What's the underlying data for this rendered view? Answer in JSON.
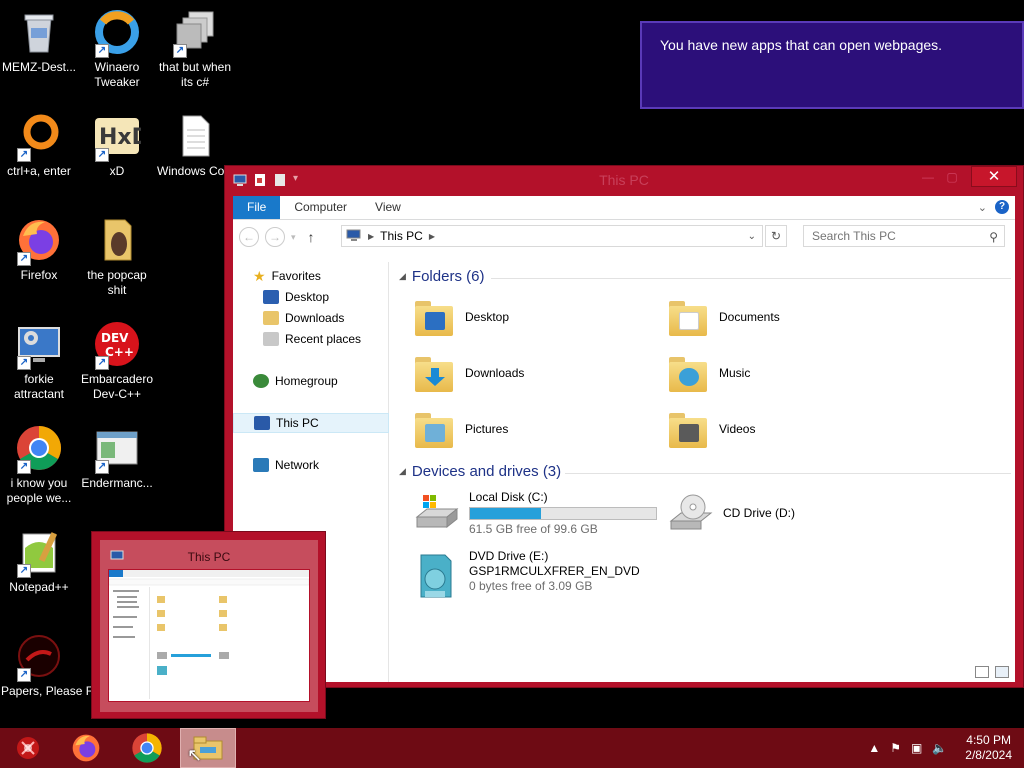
{
  "desktop": {
    "icons": [
      {
        "label": "MEMZ-Dest...",
        "icon": "recycle-bin-icon"
      },
      {
        "label": "Winaero Tweaker",
        "icon": "winaero-icon"
      },
      {
        "label": "that but when its c#",
        "icon": "windows-stack-icon"
      },
      {
        "label": "ctrl+a, enter",
        "icon": "ring-icon"
      },
      {
        "label": "xD",
        "icon": "hxd-icon"
      },
      {
        "label": "Windows Compatibili...",
        "icon": "document-icon"
      },
      {
        "label": "Firefox",
        "icon": "firefox-icon"
      },
      {
        "label": "the popcap shit",
        "icon": "popcap-folder-icon"
      },
      {
        "label": "forkie attractant",
        "icon": "monitor-gear-icon"
      },
      {
        "label": "Embarcadero Dev-C++",
        "icon": "devcpp-icon"
      },
      {
        "label": "i know you people we...",
        "icon": "chrome-icon"
      },
      {
        "label": "Endermanc...",
        "icon": "window-icon"
      },
      {
        "label": "Notepad++",
        "icon": "notepadpp-icon"
      },
      {
        "label": "Papers, Please Fo...",
        "icon": "papers-please-icon"
      }
    ]
  },
  "notification": {
    "text": "You have new apps that can open webpages."
  },
  "explorer": {
    "title": "This PC",
    "close_label": "✕",
    "tabs": [
      {
        "label": "File"
      },
      {
        "label": "Computer"
      },
      {
        "label": "View"
      }
    ],
    "address": {
      "location": "This PC"
    },
    "search": {
      "placeholder": "Search This PC"
    },
    "nav": {
      "favorites": "Favorites",
      "desktop": "Desktop",
      "downloads": "Downloads",
      "recent": "Recent places",
      "homegroup": "Homegroup",
      "thispc": "This PC",
      "network": "Network"
    },
    "groups": {
      "folders_header": "Folders (6)",
      "drives_header": "Devices and drives (3)"
    },
    "folders": [
      {
        "name": "Desktop",
        "icon": "desktop-folder-icon",
        "accent": "#2b6fc2"
      },
      {
        "name": "Documents",
        "icon": "documents-folder-icon",
        "accent": "#ffffff"
      },
      {
        "name": "Downloads",
        "icon": "downloads-folder-icon",
        "accent": "#1a8ad6"
      },
      {
        "name": "Music",
        "icon": "music-folder-icon",
        "accent": "#3aa0d8"
      },
      {
        "name": "Pictures",
        "icon": "pictures-folder-icon",
        "accent": "#6fb0d8"
      },
      {
        "name": "Videos",
        "icon": "videos-folder-icon",
        "accent": "#5a5a5a"
      }
    ],
    "drives": [
      {
        "name": "Local Disk (C:)",
        "free": "61.5 GB free of 99.6 GB",
        "used_fraction": 0.38,
        "icon": "local-disk-icon"
      },
      {
        "name": "CD Drive (D:)",
        "icon": "cd-drive-icon"
      },
      {
        "name": "DVD Drive (E:)",
        "volume": "GSP1RMCULXFRER_EN_DVD",
        "free": "0 bytes free of 3.09 GB",
        "icon": "dvd-drive-icon"
      }
    ]
  },
  "thumbnail": {
    "title": "This PC"
  },
  "taskbar": {
    "time": "4:50 PM",
    "date": "2/8/2024",
    "apps": [
      "start-orb-icon",
      "firefox-icon",
      "chrome-icon",
      "file-explorer-icon"
    ]
  },
  "colors": {
    "window_frame": "#b3112a",
    "taskbar": "#6e0b14",
    "notification": "#2c0f7a",
    "accent": "#1979ca"
  }
}
